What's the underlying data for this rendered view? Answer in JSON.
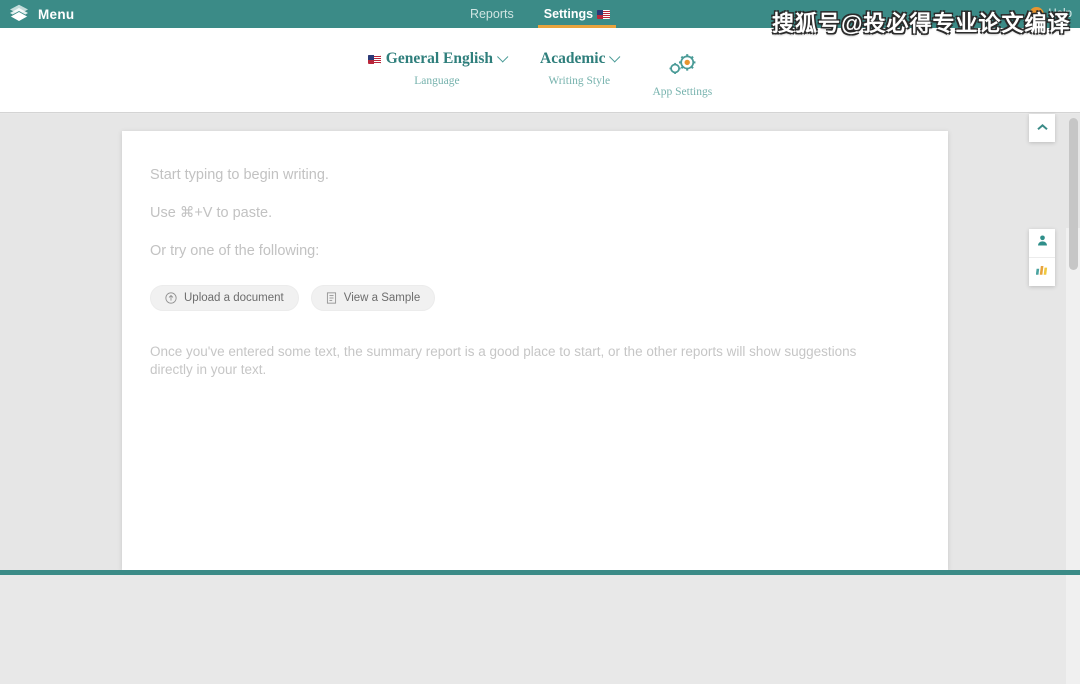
{
  "topbar": {
    "menu_label": "Menu",
    "logo_icon": "stacked-sheets-logo",
    "nav": [
      {
        "label": "Reports",
        "icon": "",
        "active": false
      },
      {
        "label": "Settings",
        "icon": "us-flag-icon",
        "active": true
      }
    ],
    "help_label": "Help",
    "help_icon": "help-circle-icon",
    "background_color": "#3b8b87",
    "active_underline_color": "#e8a33d"
  },
  "watermark": {
    "text": "搜狐号@投必得专业论文编译"
  },
  "settings_bar": {
    "language": {
      "value": "General English",
      "label": "Language",
      "flag_icon": "us-flag-icon",
      "chevron_icon": "chevron-down-icon"
    },
    "writing_style": {
      "value": "Academic",
      "label": "Writing Style",
      "chevron_icon": "chevron-down-icon"
    },
    "app_settings": {
      "label": "App Settings",
      "icon": "gears-icon"
    },
    "accent_color": "#2f7f7c",
    "sub_color": "#76b2ad"
  },
  "document": {
    "placeholder_lines": [
      "Start typing to begin writing.",
      "Use ⌘+V to paste.",
      "Or try one of the following:"
    ],
    "buttons": [
      {
        "label": "Upload a document",
        "icon": "upload-circle-icon"
      },
      {
        "label": "View a Sample",
        "icon": "document-icon"
      }
    ],
    "summary_text": "Once you've entered some text, the summary report is a good place to start, or the other reports will show suggestions directly in your text."
  },
  "right_rail": {
    "collapse_icon": "chevron-up-icon",
    "tabs": [
      {
        "icon": "person-icon",
        "name": "user-tab"
      },
      {
        "icon": "bar-chart-icon",
        "name": "reports-tab"
      }
    ],
    "bar_chart_colors": [
      "#4aa3a0",
      "#e8a33d",
      "#f0c93f"
    ],
    "person_color": "#2f8f8a"
  }
}
